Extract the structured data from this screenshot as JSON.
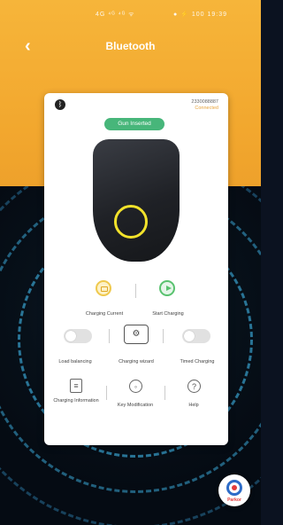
{
  "status_bar": {
    "left_indicators": "4G ⁴ᴳ ⁴ᴳ ᯤ",
    "right_indicators": "● ⚡ 100 19:39"
  },
  "header": {
    "title": "Bluetooth",
    "back_icon": "chevron-left-icon"
  },
  "card": {
    "bluetooth_icon": "bluetooth-icon",
    "device_serial": "2330088887",
    "connection_status": "Connected",
    "gun_status": "Gun Inserted",
    "actions_row1": [
      {
        "label": "Charging Current",
        "icon": "battery-icon"
      },
      {
        "label": "Start Charging",
        "icon": "play-icon"
      }
    ],
    "actions_row2": [
      {
        "label": "Load balancing",
        "icon": "toggle-icon",
        "state": "off"
      },
      {
        "label": "Charging wizard",
        "icon": "wizard-icon"
      },
      {
        "label": "Timed Charging",
        "icon": "toggle-icon",
        "state": "off"
      }
    ],
    "actions_row3": [
      {
        "label": "Charging Information",
        "icon": "document-icon"
      },
      {
        "label": "Key Modification",
        "icon": "key-icon"
      },
      {
        "label": "Help",
        "icon": "question-icon"
      }
    ]
  },
  "fab": {
    "label": "Parkor",
    "icon": "app-logo-icon"
  },
  "colors": {
    "header": "#f2a72e",
    "pill": "#47b67a",
    "accent_yellow": "#f2e22b",
    "connected": "#e7a33a"
  }
}
